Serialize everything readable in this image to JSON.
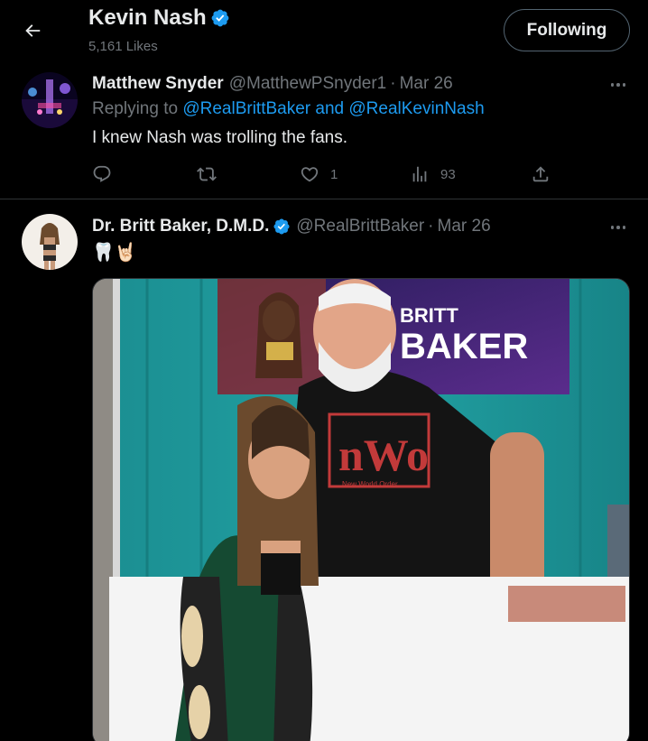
{
  "header": {
    "title": "Kevin Nash",
    "likes": "5,161 Likes",
    "following_label": "Following"
  },
  "tweet1": {
    "name": "Matthew Snyder",
    "handle": "@MatthewPSnyder1",
    "dot": "·",
    "date": "Mar 26",
    "replying_prefix": "Replying to ",
    "mention1": "@RealBrittBaker",
    "and": " and ",
    "mention2": "@RealKevinNash",
    "text": "I knew Nash was trolling the fans.",
    "likes": "1",
    "views": "93"
  },
  "tweet2": {
    "name": "Dr. Britt Baker, D.M.D.",
    "handle": "@RealBrittBaker",
    "dot": "·",
    "date": "Mar 26",
    "text": "🦷🤘🏻"
  },
  "media": {
    "poster_text_line1": "BRITT",
    "poster_text_line2": "BAKER",
    "shirt_text": "nWo",
    "shirt_subtext": "New World Order"
  },
  "colors": {
    "accent": "#1d9bf0",
    "muted": "#71767b",
    "divider": "#2f3336"
  },
  "icons": [
    "back-arrow-icon",
    "verified-badge-icon",
    "more-icon",
    "reply-icon",
    "retweet-icon",
    "like-icon",
    "views-icon",
    "share-icon"
  ]
}
